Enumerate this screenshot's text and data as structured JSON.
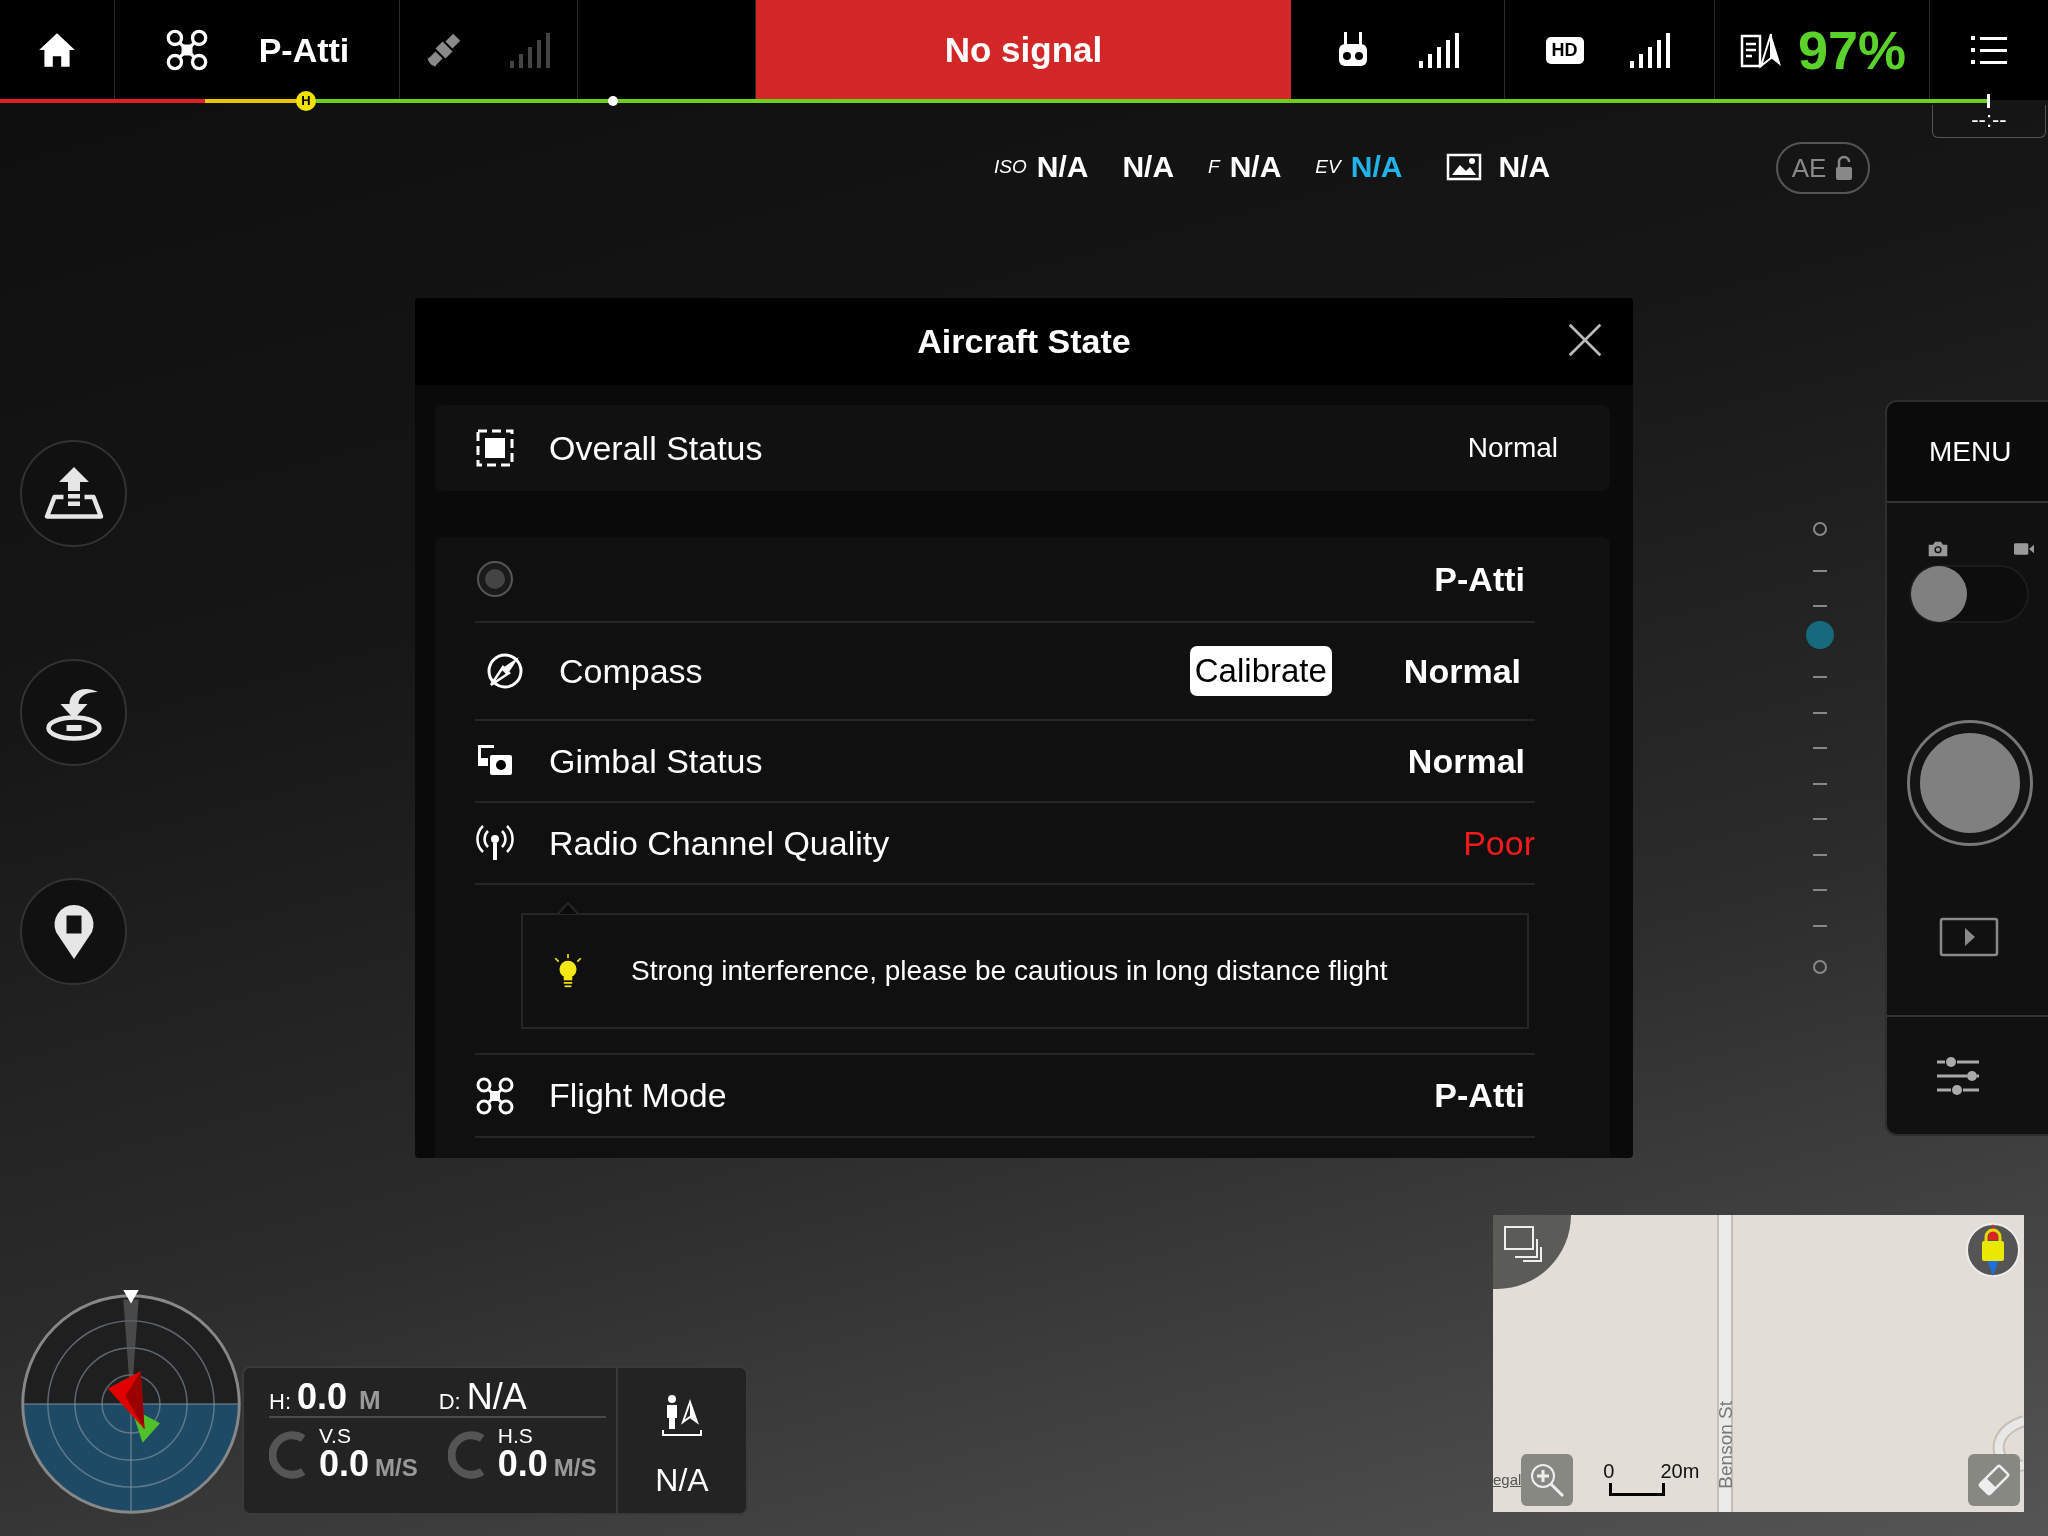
{
  "top_bar": {
    "flight_mode": "P-Atti",
    "alert": "No signal",
    "hd_label": "HD",
    "battery": "97%",
    "home_marker": "H",
    "flight_timer": "--:--"
  },
  "camera_settings": [
    {
      "kind": "labeled",
      "label": "ISO",
      "value": "N/A",
      "accent": false
    },
    {
      "kind": "plain",
      "value": "N/A",
      "accent": false
    },
    {
      "kind": "labeled",
      "label": "F",
      "value": "N/A",
      "accent": false
    },
    {
      "kind": "labeled",
      "label": "EV",
      "value": "N/A",
      "accent": true
    },
    {
      "kind": "format",
      "value": "N/A",
      "accent": false
    }
  ],
  "ae_button": {
    "label": "AE",
    "locked": false
  },
  "side_buttons": [
    {
      "kind": "takeoff"
    },
    {
      "kind": "return_home"
    },
    {
      "kind": "home_point"
    }
  ],
  "dialog": {
    "title": "Aircraft State",
    "overall": {
      "label": "Overall Status",
      "value": "Normal"
    },
    "rows": [
      {
        "kind": "mode_switch",
        "value": "P-Atti",
        "warning": false
      },
      {
        "kind": "compass",
        "label": "Compass",
        "action": "Calibrate",
        "value": "Normal",
        "warning": false
      },
      {
        "kind": "gimbal",
        "label": "Gimbal Status",
        "value": "Normal",
        "warning": false
      },
      {
        "kind": "radio",
        "label": "Radio Channel Quality",
        "value": "Poor",
        "warning": true,
        "tip": "Strong interference, please be cautious in long distance flight"
      },
      {
        "kind": "flight_mode",
        "label": "Flight Mode",
        "value": "P-Atti",
        "warning": false
      }
    ]
  },
  "gimbal_slider": {
    "level": 0.75
  },
  "capture_panel": {
    "menu": "MENU",
    "video": false
  },
  "telemetry": {
    "height": {
      "label": "H:",
      "value": "0.0",
      "unit": "M"
    },
    "distance": {
      "label": "D:",
      "value": "N/A"
    },
    "speeds": [
      {
        "label": "V.S",
        "value": "0.0",
        "unit": "M/S"
      },
      {
        "label": "H.S",
        "value": "0.0",
        "unit": "M/S"
      }
    ],
    "home_distance": "N/A"
  },
  "map": {
    "street": "Benson St",
    "legal": "egal",
    "scale_start": "0",
    "scale_end": "20m"
  }
}
